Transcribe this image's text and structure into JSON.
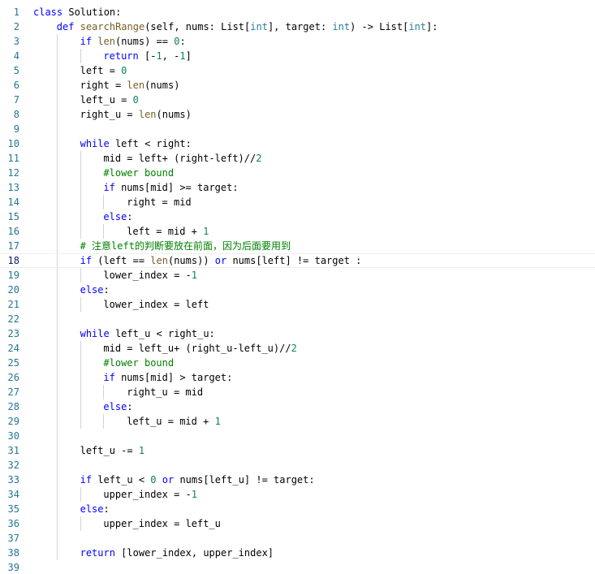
{
  "editor": {
    "lines": [
      {
        "n": "1",
        "indent": 0,
        "tokens": [
          [
            "kw",
            "class"
          ],
          [
            "tx",
            " Solution:"
          ]
        ]
      },
      {
        "n": "2",
        "indent": 1,
        "tokens": [
          [
            "kw",
            "def"
          ],
          [
            "tx",
            " "
          ],
          [
            "fn",
            "searchRange"
          ],
          [
            "tx",
            "(self, nums: List["
          ],
          [
            "bi",
            "int"
          ],
          [
            "tx",
            "], target: "
          ],
          [
            "bi",
            "int"
          ],
          [
            "tx",
            ") -> List["
          ],
          [
            "bi",
            "int"
          ],
          [
            "tx",
            "]:"
          ]
        ]
      },
      {
        "n": "3",
        "indent": 2,
        "tokens": [
          [
            "kw",
            "if"
          ],
          [
            "tx",
            " "
          ],
          [
            "fn",
            "len"
          ],
          [
            "tx",
            "(nums) == "
          ],
          [
            "num",
            "0"
          ],
          [
            "tx",
            ":"
          ]
        ]
      },
      {
        "n": "4",
        "indent": 3,
        "tokens": [
          [
            "kw",
            "return"
          ],
          [
            "tx",
            " [-"
          ],
          [
            "num",
            "1"
          ],
          [
            "tx",
            ", -"
          ],
          [
            "num",
            "1"
          ],
          [
            "tx",
            "]"
          ]
        ]
      },
      {
        "n": "5",
        "indent": 2,
        "tokens": [
          [
            "tx",
            "left = "
          ],
          [
            "num",
            "0"
          ]
        ]
      },
      {
        "n": "6",
        "indent": 2,
        "tokens": [
          [
            "tx",
            "right = "
          ],
          [
            "fn",
            "len"
          ],
          [
            "tx",
            "(nums)"
          ]
        ]
      },
      {
        "n": "7",
        "indent": 2,
        "tokens": [
          [
            "tx",
            "left_u = "
          ],
          [
            "num",
            "0"
          ]
        ]
      },
      {
        "n": "8",
        "indent": 2,
        "tokens": [
          [
            "tx",
            "right_u = "
          ],
          [
            "fn",
            "len"
          ],
          [
            "tx",
            "(nums)"
          ]
        ]
      },
      {
        "n": "9",
        "indent": 2,
        "tokens": []
      },
      {
        "n": "10",
        "indent": 2,
        "tokens": [
          [
            "kw",
            "while"
          ],
          [
            "tx",
            " left < right:"
          ]
        ]
      },
      {
        "n": "11",
        "indent": 3,
        "tokens": [
          [
            "tx",
            "mid = left+ (right-left)//"
          ],
          [
            "num",
            "2"
          ]
        ]
      },
      {
        "n": "12",
        "indent": 3,
        "tokens": [
          [
            "cmt",
            "#lower bound"
          ]
        ]
      },
      {
        "n": "13",
        "indent": 3,
        "tokens": [
          [
            "kw",
            "if"
          ],
          [
            "tx",
            " nums[mid] >= target:"
          ]
        ]
      },
      {
        "n": "14",
        "indent": 4,
        "tokens": [
          [
            "tx",
            "right = mid"
          ]
        ]
      },
      {
        "n": "15",
        "indent": 3,
        "tokens": [
          [
            "kw",
            "else"
          ],
          [
            "tx",
            ":"
          ]
        ]
      },
      {
        "n": "16",
        "indent": 4,
        "tokens": [
          [
            "tx",
            "left = mid + "
          ],
          [
            "num",
            "1"
          ]
        ]
      },
      {
        "n": "17",
        "indent": 2,
        "tokens": [
          [
            "cmt",
            "# 注意left的判断要放在前面，因为后面要用到"
          ]
        ]
      },
      {
        "n": "18",
        "indent": 2,
        "current": true,
        "tokens": [
          [
            "kw",
            "if"
          ],
          [
            "tx",
            " (left == "
          ],
          [
            "fn",
            "len"
          ],
          [
            "tx",
            "(nums)) "
          ],
          [
            "kw",
            "or"
          ],
          [
            "tx",
            " nums[left] != target :"
          ]
        ]
      },
      {
        "n": "19",
        "indent": 3,
        "tokens": [
          [
            "tx",
            "lower_index = -"
          ],
          [
            "num",
            "1"
          ]
        ]
      },
      {
        "n": "20",
        "indent": 2,
        "tokens": [
          [
            "kw",
            "else"
          ],
          [
            "tx",
            ":"
          ]
        ]
      },
      {
        "n": "21",
        "indent": 3,
        "tokens": [
          [
            "tx",
            "lower_index = left"
          ]
        ]
      },
      {
        "n": "22",
        "indent": 2,
        "tokens": []
      },
      {
        "n": "23",
        "indent": 2,
        "tokens": [
          [
            "kw",
            "while"
          ],
          [
            "tx",
            " left_u < right_u:"
          ]
        ]
      },
      {
        "n": "24",
        "indent": 3,
        "tokens": [
          [
            "tx",
            "mid = left_u+ (right_u-left_u)//"
          ],
          [
            "num",
            "2"
          ]
        ]
      },
      {
        "n": "25",
        "indent": 3,
        "tokens": [
          [
            "cmt",
            "#lower bound"
          ]
        ]
      },
      {
        "n": "26",
        "indent": 3,
        "tokens": [
          [
            "kw",
            "if"
          ],
          [
            "tx",
            " nums[mid] > target:"
          ]
        ]
      },
      {
        "n": "27",
        "indent": 4,
        "tokens": [
          [
            "tx",
            "right_u = mid"
          ]
        ]
      },
      {
        "n": "28",
        "indent": 3,
        "tokens": [
          [
            "kw",
            "else"
          ],
          [
            "tx",
            ":"
          ]
        ]
      },
      {
        "n": "29",
        "indent": 4,
        "tokens": [
          [
            "tx",
            "left_u = mid + "
          ],
          [
            "num",
            "1"
          ]
        ]
      },
      {
        "n": "30",
        "indent": 2,
        "tokens": []
      },
      {
        "n": "31",
        "indent": 2,
        "tokens": [
          [
            "tx",
            "left_u -= "
          ],
          [
            "num",
            "1"
          ]
        ]
      },
      {
        "n": "32",
        "indent": 2,
        "tokens": []
      },
      {
        "n": "33",
        "indent": 2,
        "tokens": [
          [
            "kw",
            "if"
          ],
          [
            "tx",
            " left_u < "
          ],
          [
            "num",
            "0"
          ],
          [
            "tx",
            " "
          ],
          [
            "kw",
            "or"
          ],
          [
            "tx",
            " nums[left_u] != target:"
          ]
        ]
      },
      {
        "n": "34",
        "indent": 3,
        "tokens": [
          [
            "tx",
            "upper_index = -"
          ],
          [
            "num",
            "1"
          ]
        ]
      },
      {
        "n": "35",
        "indent": 2,
        "tokens": [
          [
            "kw",
            "else"
          ],
          [
            "tx",
            ":"
          ]
        ]
      },
      {
        "n": "36",
        "indent": 3,
        "tokens": [
          [
            "tx",
            "upper_index = left_u"
          ]
        ]
      },
      {
        "n": "37",
        "indent": 2,
        "tokens": []
      },
      {
        "n": "38",
        "indent": 2,
        "tokens": [
          [
            "kw",
            "return"
          ],
          [
            "tx",
            " [lower_index, upper_index]"
          ]
        ]
      },
      {
        "n": "39",
        "indent": 0,
        "tokens": []
      }
    ]
  }
}
